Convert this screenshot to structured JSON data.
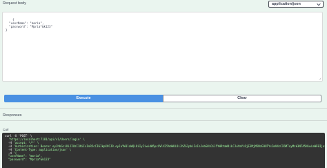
{
  "request_body": {
    "title": "Request body",
    "content_type": "application/json",
    "body_text": "{\n  \"userName\": \"maria\",\n  \"password\": \"Mpria*&k123\"\n}"
  },
  "actions": {
    "execute_label": "Execute",
    "clear_label": "Clear"
  },
  "responses": {
    "title": "Responses",
    "curl_label": "Curl",
    "curl_lines": [
      {
        "plain": "curl -X 'POST' \\",
        "str": ""
      },
      {
        "plain": "  ",
        "str": "'https://localhost:7181/api/v1/Users/login' \\"
      },
      {
        "plain": "  -H ",
        "str": "'accept: */*' \\"
      },
      {
        "plain": "  -H ",
        "str": "'Authorization: Bearer eyJhbGciOiJIUzI1NiIsInR5cCI6IkpXVCJ9.eyJuYW1laWQiOiIyIiwidW5pcXVlX25hbWUiOiJhZG1pbiIsInJvbGUiOiJ5YWRtaW4iLCJuYmYiOjE3MjM5NzE0OTYsImV4cCI6MTcyMzk3NTA5NiwiaWF0IjoxNzIzOTcxNDk2fQ' \\"
      },
      {
        "plain": "  -H ",
        "str": "'Content-Type: application/json' \\"
      },
      {
        "plain": "  -d ",
        "str": "'{"
      },
      {
        "plain": "",
        "str": "  \"userName\": \"maria\","
      },
      {
        "plain": "",
        "str": "  \"password\": \"Mpria*&k123\""
      }
    ]
  },
  "colors": {
    "execute_bg": "#4990e2",
    "page_bg": "#eaf5ef",
    "curl_bg": "#333333",
    "curl_string": "#a2fca2"
  },
  "icons": {
    "select_chevron": "chevron-down-icon",
    "editor_resize": "resize-handle-icon"
  }
}
